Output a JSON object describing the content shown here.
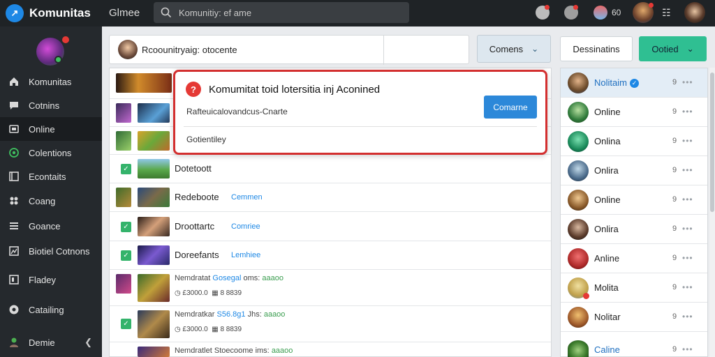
{
  "topbar": {
    "brand": "Komunitas",
    "game_label": "Glmee",
    "search_placeholder": "Komunitiy: ef ame",
    "notif_count": "60"
  },
  "sidebar": {
    "items": [
      {
        "label": "Komunitas",
        "icon": "home-icon"
      },
      {
        "label": "Cotnins",
        "icon": "chat-icon"
      },
      {
        "label": "Online",
        "icon": "game-icon",
        "active": true
      },
      {
        "label": "Colentions",
        "icon": "collection-icon"
      },
      {
        "label": "Econtaits",
        "icon": "events-icon"
      },
      {
        "label": "Coang",
        "icon": "controller-icon"
      },
      {
        "label": "Goance",
        "icon": "list-icon"
      },
      {
        "label": "Biotiel Cotnons",
        "icon": "library-icon"
      },
      {
        "label": "Fladey",
        "icon": "play-icon"
      },
      {
        "label": "Catailing",
        "icon": "support-icon"
      },
      {
        "label": "Demie",
        "icon": "user-icon"
      }
    ]
  },
  "header": {
    "title": "Rcoounitryaig: otocente",
    "filter_label": "Comens",
    "desc_label": "Dessinatins",
    "online_label": "Ootied"
  },
  "dialog": {
    "title": "Komumitat toid lotersitia inj Aconined",
    "subtitle": "Rafteuicalovandcus-Cnarte",
    "button": "Comarne",
    "footer": "Gotientiley"
  },
  "games": [
    {
      "name": "Dotetoott",
      "status": ""
    },
    {
      "name": "Redeboote",
      "status": "Cemmen"
    },
    {
      "name": "Droottartc",
      "status": "Comriee"
    },
    {
      "name": "Doreefants",
      "status": "Lemhiee"
    },
    {
      "name": "Nemdratat",
      "price": "Gosegal",
      "meta1": "oms:",
      "tag1": "aaaoo",
      "meta2": "£3000.0",
      "meta3": "8 8839"
    },
    {
      "name": "Nemdratkar",
      "price": "S56.8g1",
      "meta1": "Jhs:",
      "tag1": "aaaoo",
      "meta2": "£3000.0",
      "meta3": "8 8839"
    },
    {
      "name": "Nemdratlet",
      "price": "Stoecoome",
      "meta1": "ims:",
      "tag1": "aaaoo"
    }
  ],
  "friends": [
    {
      "name": "Nolitaim",
      "count": "9",
      "verified": true
    },
    {
      "name": "Online",
      "count": "9"
    },
    {
      "name": "Onlina",
      "count": "9"
    },
    {
      "name": "Onlira",
      "count": "9"
    },
    {
      "name": "Online",
      "count": "9"
    },
    {
      "name": "Onlira",
      "count": "9"
    },
    {
      "name": "Anline",
      "count": "9"
    },
    {
      "name": "Molita",
      "count": "9"
    },
    {
      "name": "Nolitar",
      "count": "9"
    },
    {
      "name": "Caline",
      "count": "9"
    }
  ],
  "colors": {
    "accent": "#1e88e5",
    "online_button": "#2fbf92",
    "dialog_border": "#d32f2f",
    "sidebar_bg": "#25292d"
  }
}
